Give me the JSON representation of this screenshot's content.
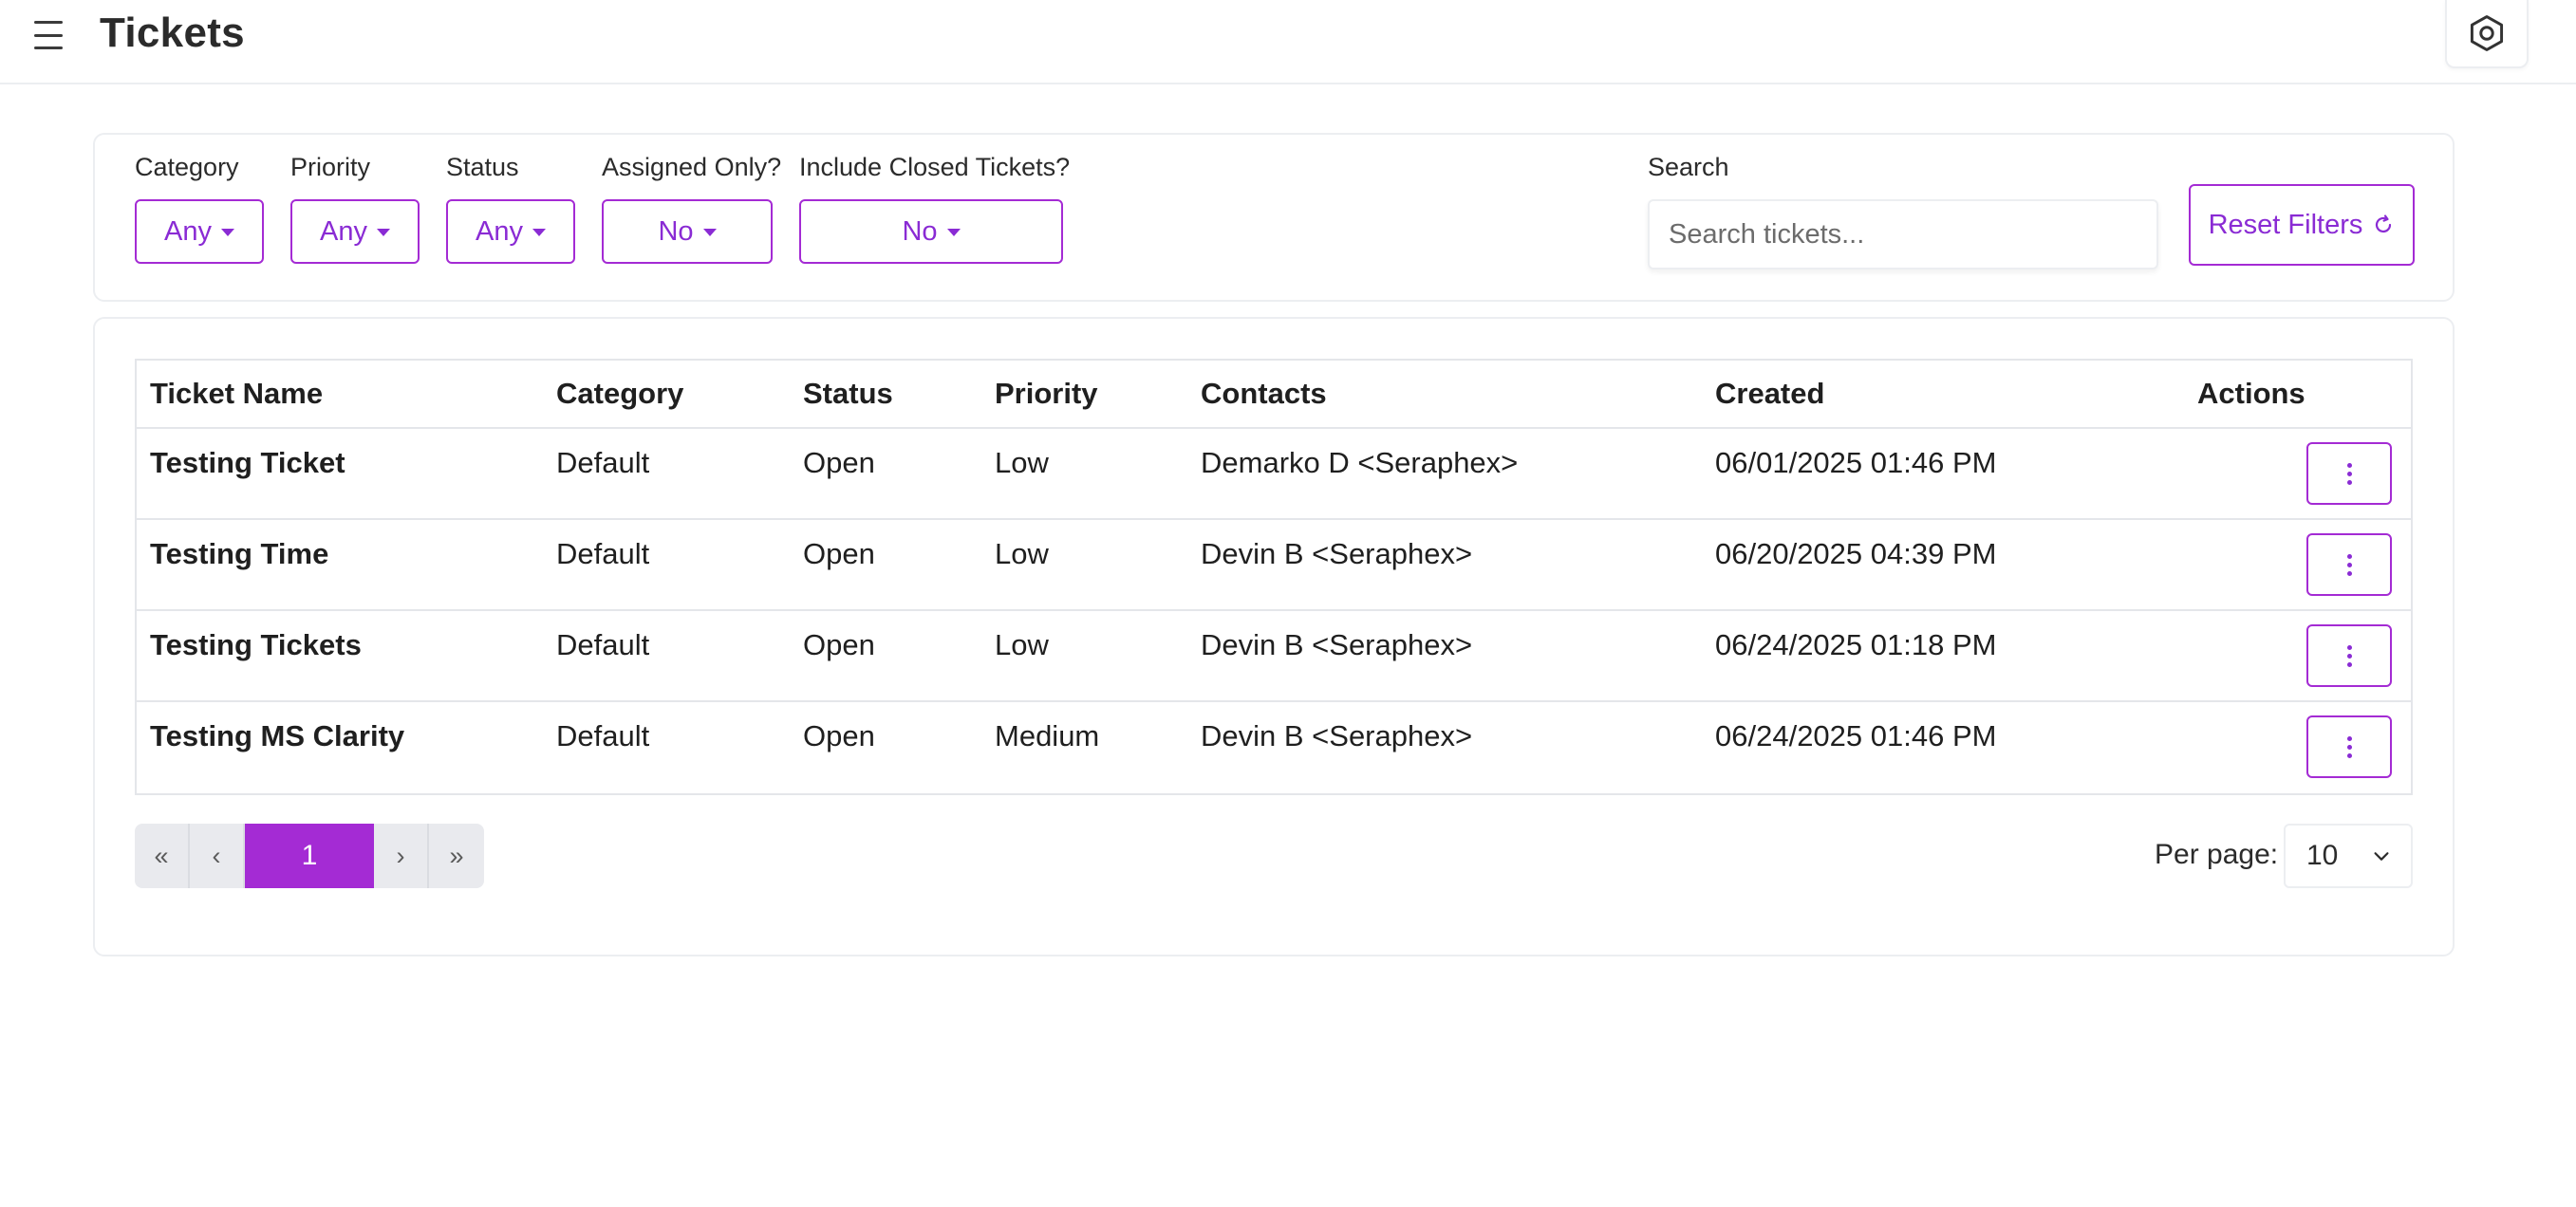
{
  "header": {
    "title": "Tickets",
    "menu_icon": "hamburger-menu-icon",
    "settings_icon": "hexagon-settings-icon"
  },
  "filters": {
    "category": {
      "label": "Category",
      "value": "Any"
    },
    "priority": {
      "label": "Priority",
      "value": "Any"
    },
    "status": {
      "label": "Status",
      "value": "Any"
    },
    "assigned_only": {
      "label": "Assigned Only?",
      "value": "No"
    },
    "include_closed": {
      "label": "Include Closed Tickets?",
      "value": "No"
    },
    "search": {
      "label": "Search",
      "placeholder": "Search tickets...",
      "value": ""
    },
    "reset_label": "Reset Filters"
  },
  "table": {
    "columns": [
      "Ticket Name",
      "Category",
      "Status",
      "Priority",
      "Contacts",
      "Created",
      "Actions"
    ],
    "rows": [
      {
        "name": "Testing Ticket",
        "category": "Default",
        "status": "Open",
        "priority": "Low",
        "contacts": "Demarko D <Seraphex>",
        "created": "06/01/2025 01:46 PM"
      },
      {
        "name": "Testing Time",
        "category": "Default",
        "status": "Open",
        "priority": "Low",
        "contacts": "Devin B <Seraphex>",
        "created": "06/20/2025 04:39 PM"
      },
      {
        "name": "Testing Tickets",
        "category": "Default",
        "status": "Open",
        "priority": "Low",
        "contacts": "Devin B <Seraphex>",
        "created": "06/24/2025 01:18 PM"
      },
      {
        "name": "Testing MS Clarity",
        "category": "Default",
        "status": "Open",
        "priority": "Medium",
        "contacts": "Devin B <Seraphex>",
        "created": "06/24/2025 01:46 PM"
      }
    ]
  },
  "pagination": {
    "first": "«",
    "prev": "‹",
    "current": "1",
    "next": "›",
    "last": "»",
    "per_page_label": "Per page:",
    "per_page_value": "10"
  },
  "colors": {
    "accent": "#a42bd4",
    "accent_text": "#8a2bd4",
    "border": "#eceef1"
  }
}
